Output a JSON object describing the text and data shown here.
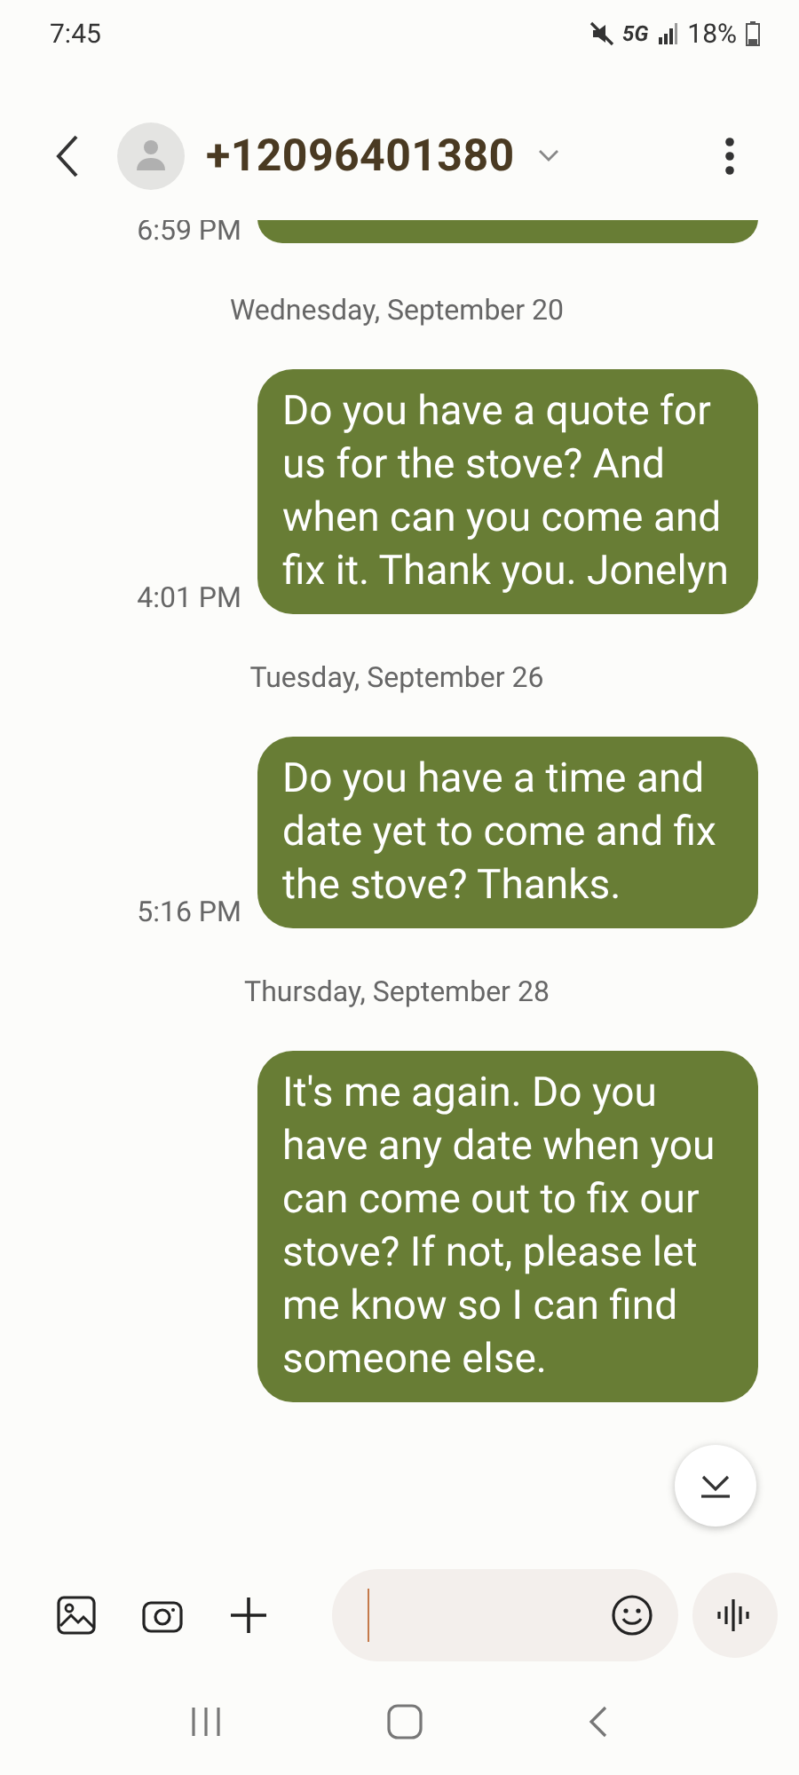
{
  "status_bar": {
    "time": "7:45",
    "battery": "18%",
    "network": "5G"
  },
  "header": {
    "contact": "+12096401380"
  },
  "messages": [
    {
      "kind": "stub",
      "time": "6:59 PM"
    },
    {
      "kind": "date",
      "text": "Wednesday, September 20"
    },
    {
      "kind": "sent",
      "text": "Do you have a quote for us for the stove? And when can you come and fix it. Thank you. Jonelyn",
      "time": "4:01 PM"
    },
    {
      "kind": "date",
      "text": "Tuesday, September 26"
    },
    {
      "kind": "sent",
      "text": "Do you have a time and date yet to come and fix  the stove? Thanks.",
      "time": "5:16 PM"
    },
    {
      "kind": "date",
      "text": "Thursday, September 28"
    },
    {
      "kind": "sent",
      "text": "It's me again. Do you have any date when you can come out to fix our stove? If not, please let me know so I can find someone else."
    }
  ]
}
